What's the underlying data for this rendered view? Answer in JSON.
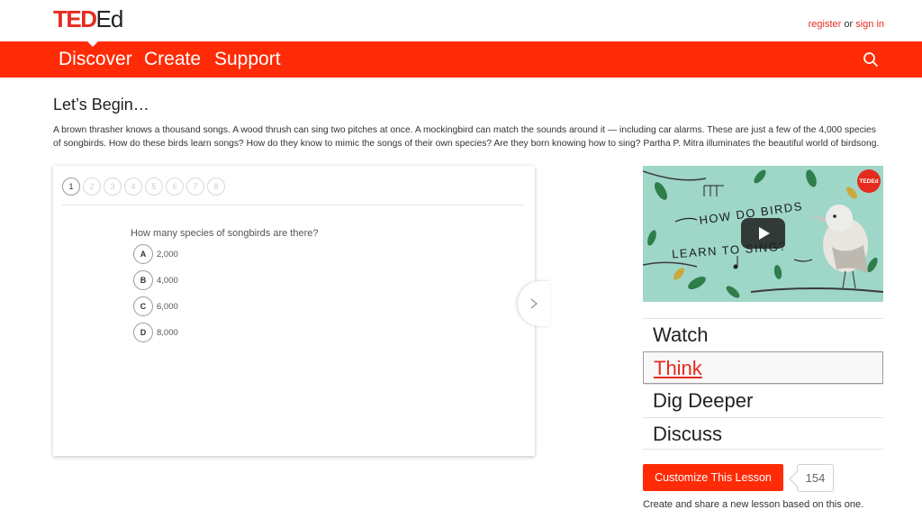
{
  "brand": {
    "ted": "TED",
    "ed": "Ed"
  },
  "auth": {
    "register": "register",
    "or": "or",
    "signin": "sign in"
  },
  "nav": {
    "discover": "Discover",
    "create": "Create",
    "support": "Support",
    "search_icon": "search-icon"
  },
  "lesson": {
    "heading": "Let’s Begin…",
    "description": "A brown thrasher knows a thousand songs. A wood thrush can sing two pitches at once. A mockingbird can match the sounds around it — including car alarms. These are just a few of the 4,000 species of songbirds. How do these birds learn songs? How do they know to mimic the songs of their own species? Are they born knowing how to sing? Partha P. Mitra illuminates the beautiful world of birdsong."
  },
  "quiz": {
    "steps": [
      "1",
      "2",
      "3",
      "4",
      "5",
      "6",
      "7",
      "8"
    ],
    "active_step": "1",
    "question": "How many species of songbirds are there?",
    "options": [
      {
        "letter": "A",
        "text": "2,000"
      },
      {
        "letter": "B",
        "text": "4,000"
      },
      {
        "letter": "C",
        "text": "6,000"
      },
      {
        "letter": "D",
        "text": "8,000"
      }
    ]
  },
  "video": {
    "title_line1": "HOW DO BIRDS",
    "title_line2": "LEARN TO SING?",
    "badge": "TEDEd",
    "background_color": "#9ed6c8"
  },
  "sidebar_menu": {
    "watch": "Watch",
    "think": "Think",
    "dig_deeper": "Dig Deeper",
    "discuss": "Discuss",
    "active": "Think"
  },
  "customize": {
    "button_label": "Customize This Lesson",
    "count": "154",
    "note": "Create and share a new lesson based on this one."
  },
  "colors": {
    "accent": "#ff2b06",
    "brand_red": "#e62b1e"
  }
}
